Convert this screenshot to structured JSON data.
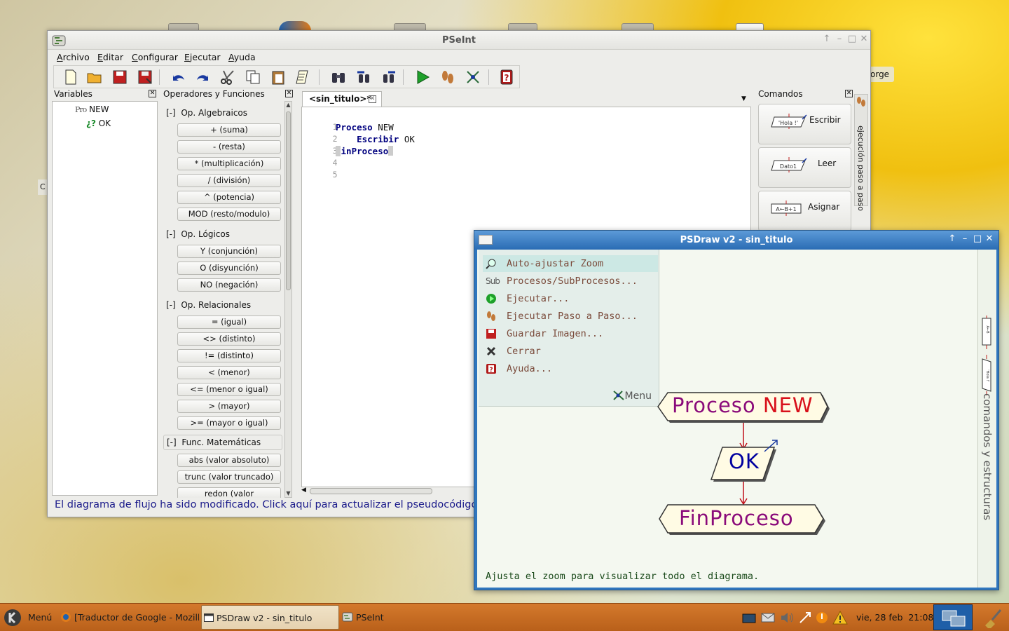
{
  "main_window": {
    "title": "PSeInt",
    "menu": [
      {
        "label": "Archivo",
        "underline": "A",
        "rest": "rchivo"
      },
      {
        "label": "Editar",
        "underline": "E",
        "rest": "ditar"
      },
      {
        "label": "Configurar",
        "underline": "C",
        "rest": "onfigurar"
      },
      {
        "label": "Ejecutar",
        "underline": "E",
        "rest": "jecutar"
      },
      {
        "label": "Ayuda",
        "underline": "A",
        "rest": "yuda"
      }
    ],
    "variables_panel": {
      "title": "Variables",
      "proc_prefix": "Pro",
      "proc_name": "NEW",
      "var_prefix": "¿?",
      "var_name": "OK"
    },
    "operators_panel": {
      "title": "Operadores y Funciones",
      "categories": [
        {
          "toggle": "[-]",
          "label": "Op. Algebraicos",
          "items": [
            "+ (suma)",
            "- (resta)",
            "* (multiplicación)",
            "/ (división)",
            "^ (potencia)",
            "MOD (resto/modulo)"
          ]
        },
        {
          "toggle": "[-]",
          "label": "Op. Lógicos",
          "items": [
            "Y (conjunción)",
            "O (disyunción)",
            "NO (negación)"
          ]
        },
        {
          "toggle": "[-]",
          "label": "Op. Relacionales",
          "items": [
            "= (igual)",
            "<> (distinto)",
            "!= (distinto)",
            "< (menor)",
            "<= (menor o igual)",
            "> (mayor)",
            ">= (mayor o igual)"
          ]
        },
        {
          "toggle": "[-]",
          "label": "Func. Matemáticas",
          "items": [
            "abs (valor absoluto)",
            "trunc (valor truncado)",
            "redon (valor redondeado)"
          ]
        }
      ]
    },
    "editor": {
      "tab_label": "<sin_titulo>*",
      "lines": [
        {
          "num": "1",
          "kw": "Proceso",
          "rest": " NEW",
          "indent": ""
        },
        {
          "num": "2",
          "kw": "Escribir",
          "rest": " OK",
          "indent": "    "
        },
        {
          "num": "3",
          "kw": "FinProceso",
          "rest": "",
          "indent": ""
        },
        {
          "num": "4",
          "kw": "",
          "rest": "",
          "indent": ""
        },
        {
          "num": "5",
          "kw": "",
          "rest": "",
          "indent": ""
        }
      ]
    },
    "commands_panel": {
      "title": "Comandos",
      "buttons": [
        {
          "label": "Escribir",
          "shape_text": "'Hola !'"
        },
        {
          "label": "Leer",
          "shape_text": "Dato1"
        },
        {
          "label": "Asignar",
          "shape_text": "A←B+1"
        }
      ],
      "side_tab": "ejecución paso a paso"
    },
    "status_message": "El diagrama de flujo ha sido modificado. Click aquí para actualizar el pseudocódigo"
  },
  "psdraw_window": {
    "title": "PSDraw v2 - sin_titulo",
    "menu_items": [
      {
        "label": "Auto-ajustar Zoom",
        "icon": "magnifier-icon",
        "highlighted": true
      },
      {
        "label": "Procesos/SubProcesos...",
        "icon": "sub-icon",
        "icon_text": "Sub"
      },
      {
        "label": "Ejecutar...",
        "icon": "play-icon"
      },
      {
        "label": "Ejecutar Paso a Paso...",
        "icon": "footsteps-icon"
      },
      {
        "label": "Guardar Imagen...",
        "icon": "save-image-icon"
      },
      {
        "label": "Cerrar",
        "icon": "close-x-icon"
      },
      {
        "label": "Ayuda...",
        "icon": "help-book-icon"
      }
    ],
    "menu_toggle": "Menu",
    "flow": {
      "start_kw": "Proceso",
      "start_name": "NEW",
      "output_text": "OK",
      "end_text": "FinProceso"
    },
    "hint": "Ajusta el zoom para visualizar todo el diagrama.",
    "side_tab": "comandos y estructuras",
    "side_shapes": [
      "A←B",
      "'Hola !'"
    ]
  },
  "desktop": {
    "partial_label": "orge",
    "left_letter": "C"
  },
  "taskbar": {
    "menu_label": "Menú",
    "tasks": [
      {
        "label": "[Traductor de Google - Mozill..."
      },
      {
        "label": "PSDraw v2 - sin_titulo"
      },
      {
        "label": "PSeInt"
      }
    ],
    "clock": "vie, 28 feb  21:08"
  },
  "colors": {
    "psdraw_title": "#2f76be",
    "flow_red": "#c0101a",
    "flow_blue": "#00009f",
    "taskbar": "#c86c22",
    "menu_highlight": "#cce8e4"
  }
}
